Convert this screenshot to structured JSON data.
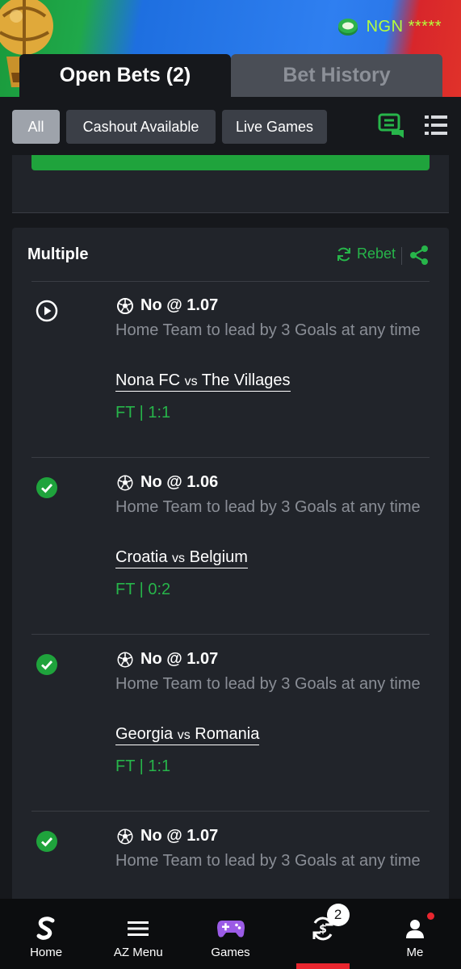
{
  "header": {
    "balance": "NGN *****",
    "colors": {
      "accent_green": "#27b54a",
      "balance_lime": "#b6ff3c",
      "active_red": "#e8262f"
    }
  },
  "tabs": [
    {
      "label": "Open Bets (2)",
      "active": true
    },
    {
      "label": "Bet History",
      "active": false
    }
  ],
  "filters": [
    {
      "label": "All",
      "selected": true
    },
    {
      "label": "Cashout Available",
      "selected": false
    },
    {
      "label": "Live Games",
      "selected": false
    }
  ],
  "toolbar_icons": [
    "chat-icon",
    "list-icon"
  ],
  "card": {
    "title": "Multiple",
    "rebet_label": "Rebet",
    "selections": [
      {
        "status": "live",
        "pick": "No @ 1.07",
        "market": "Home Team to lead by 3 Goals at any time",
        "home": "Nona FC",
        "vs": "vs",
        "away": "The Villages",
        "score": "FT | 1:1"
      },
      {
        "status": "won",
        "pick": "No @ 1.06",
        "market": "Home Team to lead by 3 Goals at any time",
        "home": "Croatia",
        "vs": "vs",
        "away": "Belgium",
        "score": "FT | 0:2"
      },
      {
        "status": "won",
        "pick": "No @ 1.07",
        "market": "Home Team to lead by 3 Goals at any time",
        "home": "Georgia",
        "vs": "vs",
        "away": "Romania",
        "score": "FT | 1:1"
      },
      {
        "status": "won",
        "pick": "No @ 1.07",
        "market": "Home Team to lead by 3 Goals at any time",
        "home": "",
        "vs": "",
        "away": "",
        "score": ""
      }
    ]
  },
  "bottom_nav": [
    {
      "label": "Home",
      "icon": "sporty-logo-icon"
    },
    {
      "label": "AZ Menu",
      "icon": "menu-icon"
    },
    {
      "label": "Games",
      "icon": "gamepad-icon"
    },
    {
      "label": "",
      "icon": "cashout-icon",
      "badge": "2",
      "active": true
    },
    {
      "label": "Me",
      "icon": "user-icon"
    }
  ]
}
